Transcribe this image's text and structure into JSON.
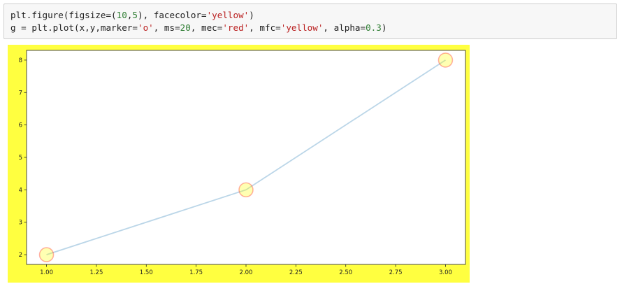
{
  "code_cell": {
    "line1": {
      "prefix": "plt.figure(figsize=(",
      "num1": "10",
      "comma": ",",
      "num2": "5",
      "mid": "), facecolor=",
      "str1": "'yellow'",
      "suffix": ")"
    },
    "line2": {
      "prefix": "g = plt.plot(x,y,marker=",
      "str1": "'o'",
      "mid1": ", ms=",
      "num1": "20",
      "mid2": ", mec=",
      "str2": "'red'",
      "mid3": ", mfc=",
      "str3": "'yellow'",
      "mid4": ", alpha=",
      "num2": "0.3",
      "suffix": ")"
    }
  },
  "colors": {
    "figure_face": "#ffff40",
    "line": "#1f77b4",
    "marker_edge": "red",
    "marker_face": "yellow",
    "alpha": 0.3
  },
  "chart_data": {
    "type": "line",
    "x": [
      1,
      2,
      3
    ],
    "y": [
      2,
      4,
      8
    ],
    "xlim": [
      0.9,
      3.1
    ],
    "ylim": [
      1.7,
      8.3
    ],
    "xticks": [
      "1.00",
      "1.25",
      "1.50",
      "1.75",
      "2.00",
      "2.25",
      "2.50",
      "2.75",
      "3.00"
    ],
    "xtick_values": [
      1.0,
      1.25,
      1.5,
      1.75,
      2.0,
      2.25,
      2.5,
      2.75,
      3.0
    ],
    "yticks": [
      "2",
      "3",
      "4",
      "5",
      "6",
      "7",
      "8"
    ],
    "ytick_values": [
      2,
      3,
      4,
      5,
      6,
      7,
      8
    ],
    "marker": "o",
    "grid": false,
    "title": "",
    "xlabel": "",
    "ylabel": ""
  }
}
